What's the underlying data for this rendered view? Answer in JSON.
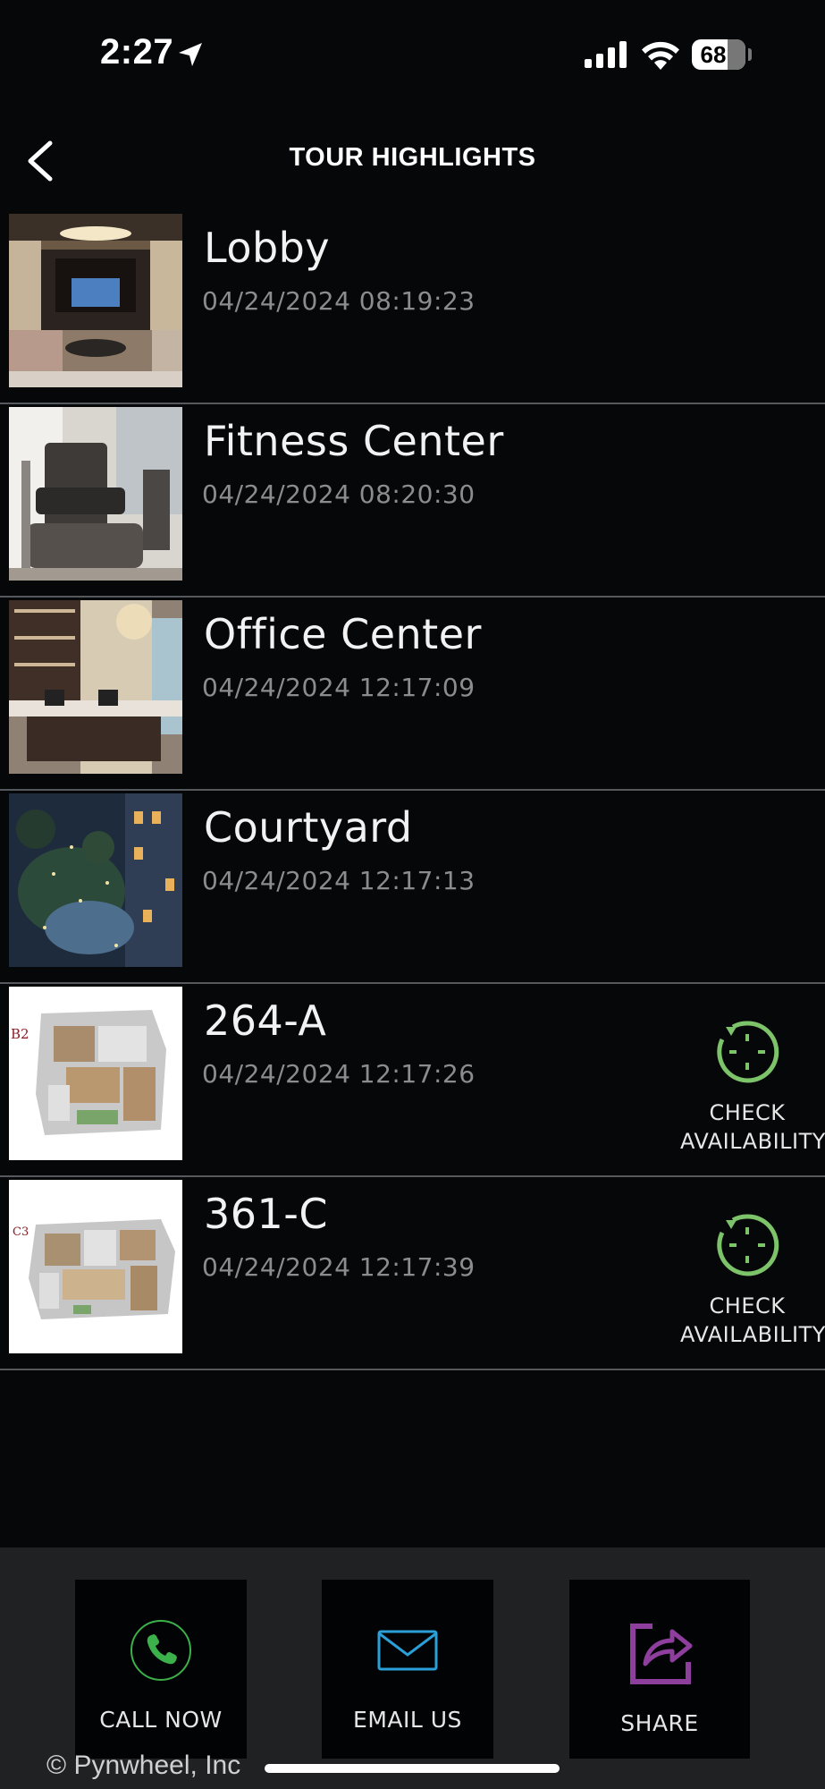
{
  "status_bar": {
    "time": "2:27",
    "battery": "68",
    "icons": [
      "location-arrow-icon",
      "cellular-signal-icon",
      "wifi-icon",
      "battery-icon"
    ]
  },
  "header": {
    "title": "TOUR HIGHLIGHTS",
    "back_icon": "chevron-left-icon"
  },
  "tour_items": [
    {
      "name": "Lobby",
      "date": "04/24/2024 08:19:23"
    },
    {
      "name": "Fitness Center",
      "date": "04/24/2024 08:20:30"
    },
    {
      "name": "Office Center",
      "date": "04/24/2024 12:17:09"
    },
    {
      "name": "Courtyard",
      "date": "04/24/2024 12:17:13"
    },
    {
      "name": "264-A",
      "date": "04/24/2024 12:17:26",
      "action_label": "CHECK\nAVAILABILITY",
      "floorplan_code": "B2"
    },
    {
      "name": "361-C",
      "date": "04/24/2024 12:17:39",
      "action_label": "CHECK\nAVAILABILITY",
      "floorplan_code": "C3"
    }
  ],
  "actions": {
    "call": {
      "label": "CALL NOW",
      "icon": "phone-icon",
      "color": "#3cb04a"
    },
    "email": {
      "label": "EMAIL US",
      "icon": "envelope-icon",
      "color": "#2a9fd8"
    },
    "share": {
      "label": "SHARE",
      "icon": "share-icon",
      "color": "#8e3f9e"
    }
  },
  "footer": {
    "copyright": "© Pynwheel, Inc"
  },
  "colors": {
    "background": "#060708",
    "divider": "#55595d",
    "availability_green": "#7cc36a",
    "bottom_bar": "#1f2123"
  }
}
